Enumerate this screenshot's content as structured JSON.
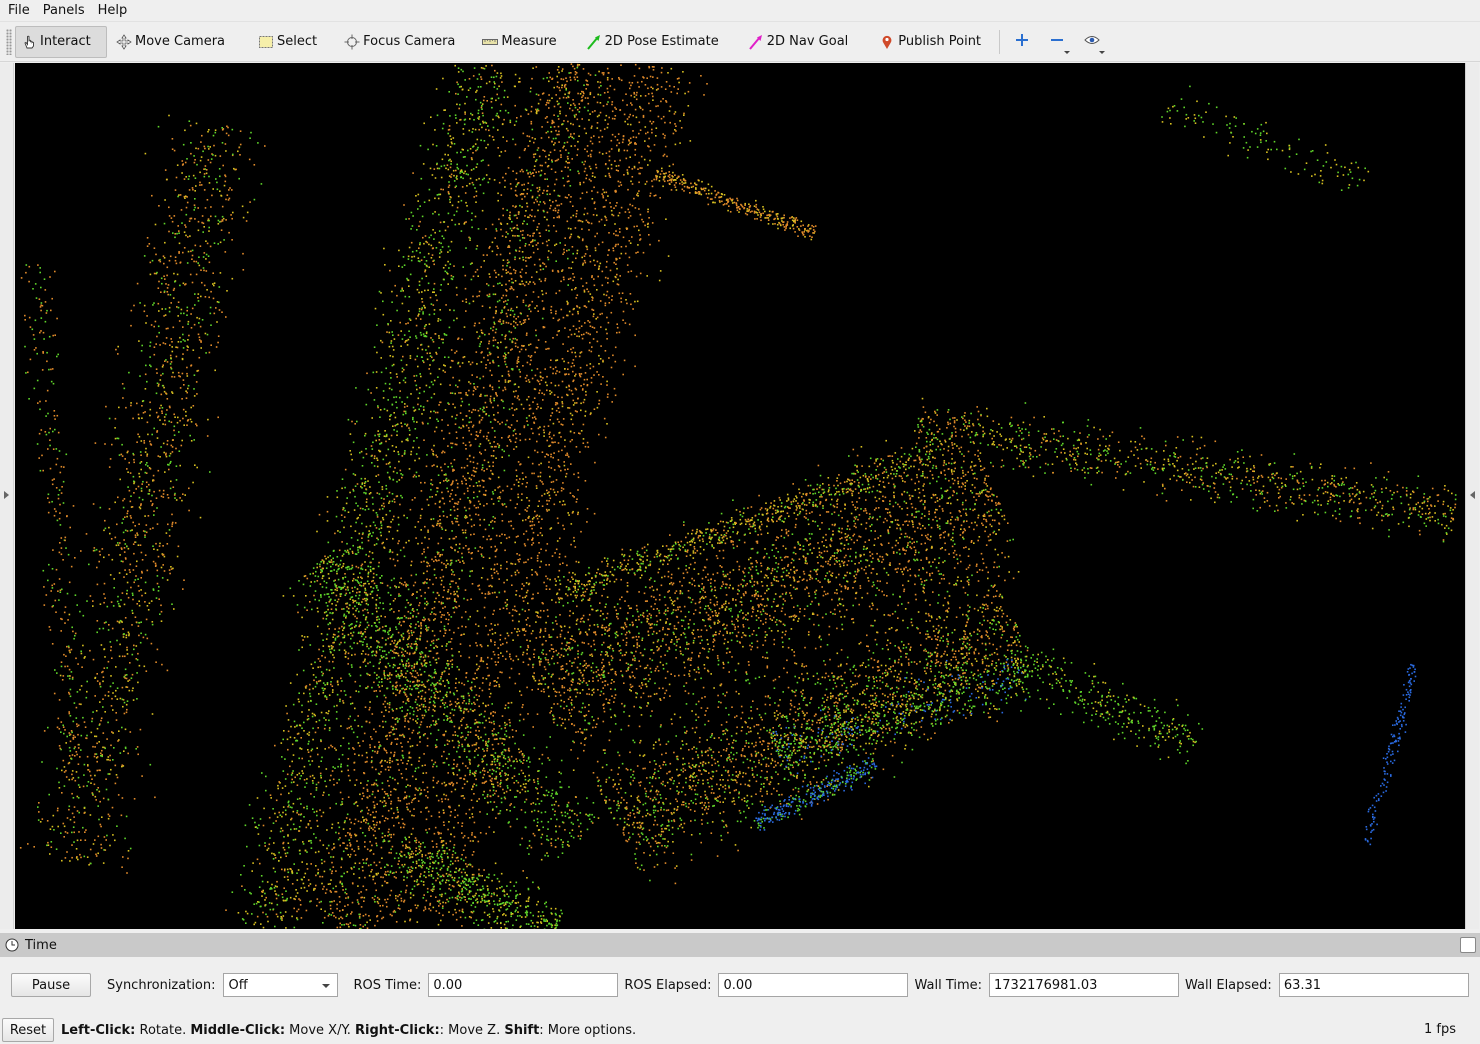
{
  "menu": {
    "file": "File",
    "panels": "Panels",
    "help": "Help"
  },
  "toolbar": {
    "interact": "Interact",
    "move_camera": "Move Camera",
    "select": "Select",
    "focus_camera": "Focus Camera",
    "measure": "Measure",
    "pose_estimate": "2D Pose Estimate",
    "nav_goal": "2D Nav Goal",
    "publish_point": "Publish Point"
  },
  "time_panel": {
    "title": "Time",
    "pause_label": "Pause",
    "sync_label": "Synchronization:",
    "sync_value": "Off",
    "ros_time_label": "ROS Time:",
    "ros_time_value": "0.00",
    "ros_elapsed_label": "ROS Elapsed:",
    "ros_elapsed_value": "0.00",
    "wall_time_label": "Wall Time:",
    "wall_time_value": "1732176981.03",
    "wall_elapsed_label": "Wall Elapsed:",
    "wall_elapsed_value": "63.31"
  },
  "status": {
    "reset_label": "Reset",
    "hint_left_key": "Left-Click:",
    "hint_left_text": " Rotate. ",
    "hint_middle_key": "Middle-Click:",
    "hint_middle_text": " Move X/Y. ",
    "hint_right_key": "Right-Click:",
    "hint_right_text": ": Move Z. ",
    "hint_shift_key": "Shift",
    "hint_shift_text": ": More options.",
    "fps": "1 fps"
  },
  "colors": {
    "viewport_bg": "#000000",
    "points_orange": "#e08a2a",
    "points_yellow": "#d8c020",
    "points_green": "#5fd52a",
    "points_blue": "#2a6ae0"
  }
}
